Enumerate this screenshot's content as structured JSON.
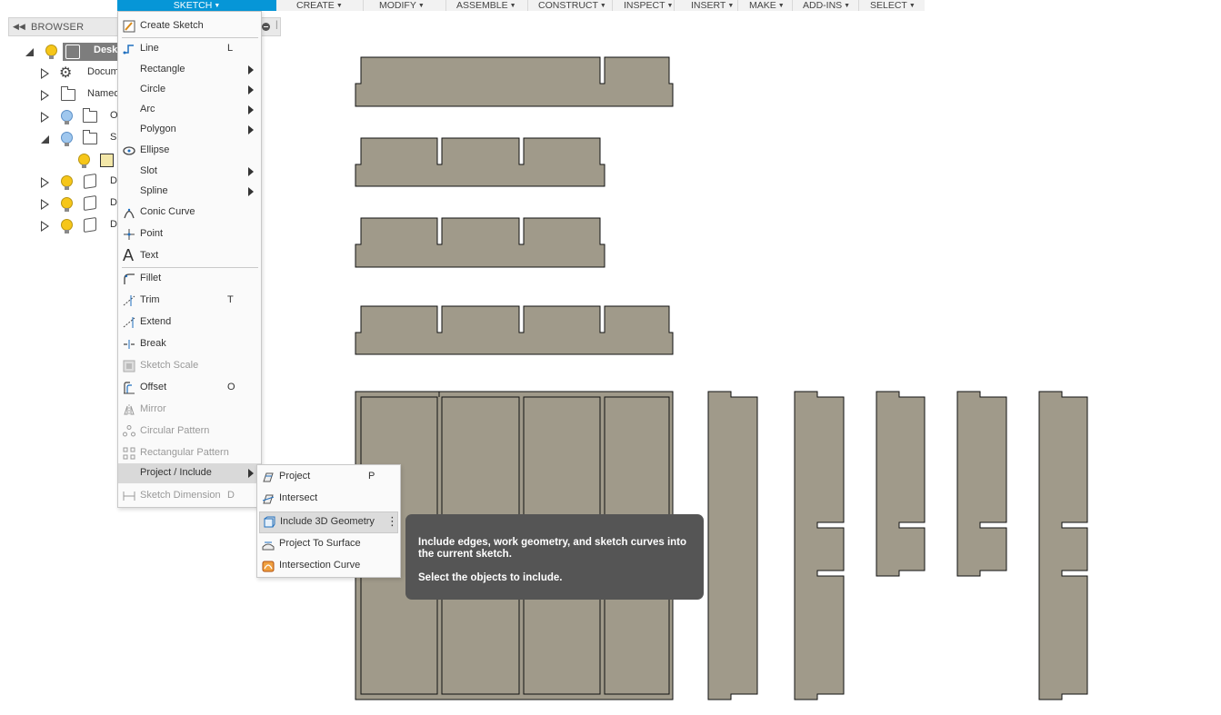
{
  "toolbar": {
    "sketch": "SKETCH",
    "create": "CREATE",
    "modify": "MODIFY",
    "assemble": "ASSEMBLE",
    "construct": "CONSTRUCT",
    "inspect": "INSPECT",
    "insert": "INSERT",
    "make": "MAKE",
    "add_ins": "ADD-INS",
    "select": "SELECT"
  },
  "browser": {
    "title": "BROWSER",
    "rows": [
      "Desk",
      "Docum",
      "Named",
      "O",
      "S",
      "",
      "D",
      "D",
      "D"
    ]
  },
  "sketch_menu": {
    "create_sketch": "Create Sketch",
    "line": {
      "label": "Line",
      "shortcut": "L"
    },
    "rectangle": "Rectangle",
    "circle": "Circle",
    "arc": "Arc",
    "polygon": "Polygon",
    "ellipse": "Ellipse",
    "slot": "Slot",
    "spline": "Spline",
    "conic_curve": "Conic Curve",
    "point": "Point",
    "text": "Text",
    "fillet": "Fillet",
    "trim": {
      "label": "Trim",
      "shortcut": "T"
    },
    "extend": "Extend",
    "break": "Break",
    "sketch_scale": "Sketch Scale",
    "offset": {
      "label": "Offset",
      "shortcut": "O"
    },
    "mirror": "Mirror",
    "circular_pattern": "Circular Pattern",
    "rectangular_pattern": "Rectangular Pattern",
    "project_include": "Project / Include",
    "sketch_dimension": {
      "label": "Sketch Dimension",
      "shortcut": "D"
    }
  },
  "submenu": {
    "project": {
      "label": "Project",
      "shortcut": "P"
    },
    "intersect": "Intersect",
    "include_3d": "Include 3D Geometry",
    "project_to_surface": "Project To Surface",
    "intersection_curve": "Intersection Curve"
  },
  "tooltip": {
    "line1": "Include edges, work geometry, and sketch curves into the current sketch.",
    "line2": "Select the objects to include."
  },
  "colors": {
    "accent": "#0696d7",
    "part_fill": "#a09a8a",
    "tooltip_bg": "#555555"
  }
}
